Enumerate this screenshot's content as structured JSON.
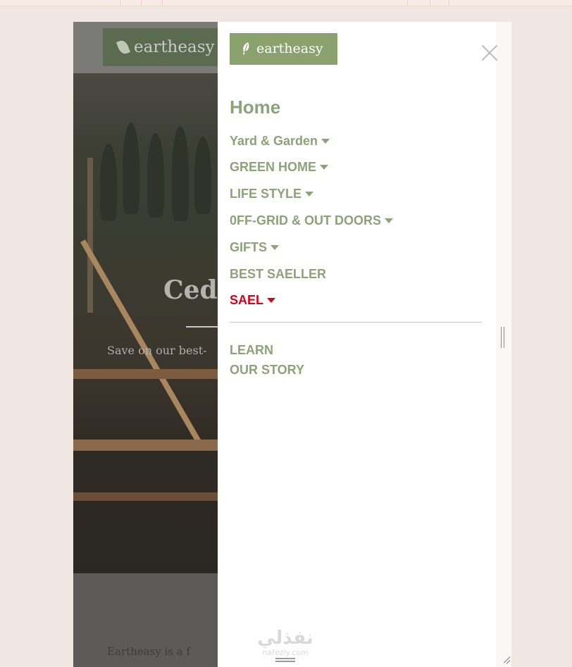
{
  "brand": {
    "name": "eartheasy",
    "color": "#89a26e",
    "background_logo_text": "eartheasy"
  },
  "menu": {
    "home_label": "Home",
    "items": [
      {
        "label": "Yard & Garden",
        "has_dropdown": true
      },
      {
        "label": "GREEN HOME",
        "has_dropdown": true
      },
      {
        "label": "LIFE STYLE",
        "has_dropdown": true
      },
      {
        "label": "0FF-GRID & OUT DOORS",
        "has_dropdown": true
      },
      {
        "label": "GIFTS",
        "has_dropdown": true
      },
      {
        "label": "BEST SAELLER",
        "has_dropdown": false
      },
      {
        "label": "SAEL",
        "has_dropdown": true,
        "color": "#d9001b"
      }
    ],
    "secondary_items": [
      {
        "label": "LEARN"
      },
      {
        "label": "OUR STORY"
      }
    ],
    "text_color": "#8ca279"
  },
  "background_page": {
    "hero_title_fragment": "Ced",
    "hero_subtitle_fragment": "Save on our best-",
    "bottom_text_fragment": "Eartheasy is a f"
  },
  "icons": {
    "close": "close-icon",
    "logo": "leaf-icon",
    "caret": "caret-down-icon"
  },
  "watermark": {
    "line1": "نفذلي",
    "line2": "nafezly.com"
  }
}
